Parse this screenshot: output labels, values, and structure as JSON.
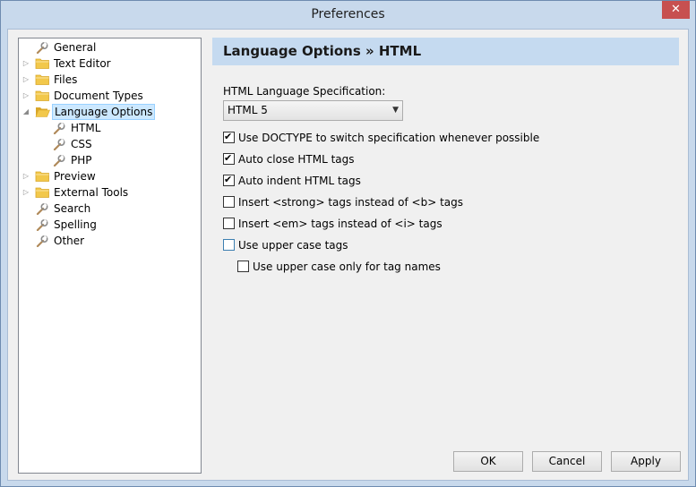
{
  "window": {
    "title": "Preferences",
    "close_glyph": "✕"
  },
  "tree": {
    "items": [
      {
        "label": "General",
        "icon": "wrench-icon",
        "level": 0,
        "expander": ""
      },
      {
        "label": "Text Editor",
        "icon": "folder-icon",
        "level": 0,
        "expander": "▷"
      },
      {
        "label": "Files",
        "icon": "folder-icon",
        "level": 0,
        "expander": "▷"
      },
      {
        "label": "Document Types",
        "icon": "folder-icon",
        "level": 0,
        "expander": "▷"
      },
      {
        "label": "Language Options",
        "icon": "folder-open-icon",
        "level": 0,
        "expander": "◢",
        "selected": true
      },
      {
        "label": "HTML",
        "icon": "wrench-icon",
        "level": 1,
        "expander": ""
      },
      {
        "label": "CSS",
        "icon": "wrench-icon",
        "level": 1,
        "expander": ""
      },
      {
        "label": "PHP",
        "icon": "wrench-icon",
        "level": 1,
        "expander": ""
      },
      {
        "label": "Preview",
        "icon": "folder-icon",
        "level": 0,
        "expander": "▷"
      },
      {
        "label": "External Tools",
        "icon": "folder-icon",
        "level": 0,
        "expander": "▷"
      },
      {
        "label": "Search",
        "icon": "wrench-icon",
        "level": 0,
        "expander": ""
      },
      {
        "label": "Spelling",
        "icon": "wrench-icon",
        "level": 0,
        "expander": ""
      },
      {
        "label": "Other",
        "icon": "wrench-icon",
        "level": 0,
        "expander": ""
      }
    ]
  },
  "panel": {
    "header": "Language Options » HTML",
    "spec_label": "HTML Language Specification:",
    "spec_value": "HTML 5",
    "spec_arrow": "▼",
    "options": [
      {
        "label": "Use DOCTYPE to switch specification whenever possible",
        "checked": true
      },
      {
        "label": "Auto close HTML tags",
        "checked": true
      },
      {
        "label": "Auto indent HTML tags",
        "checked": true
      },
      {
        "label": "Insert <strong> tags instead of <b> tags",
        "checked": false
      },
      {
        "label": "Insert <em> tags instead of <i> tags",
        "checked": false
      },
      {
        "label": "Use upper case tags",
        "checked": false
      },
      {
        "label": "Use upper case only for tag names",
        "checked": false
      }
    ]
  },
  "buttons": {
    "ok": "OK",
    "cancel": "Cancel",
    "apply": "Apply"
  },
  "colors": {
    "folder": "#f2c84b",
    "folder_dark": "#d9a72a",
    "wrench": "#b08a5a",
    "selection": "#cce8ff"
  }
}
